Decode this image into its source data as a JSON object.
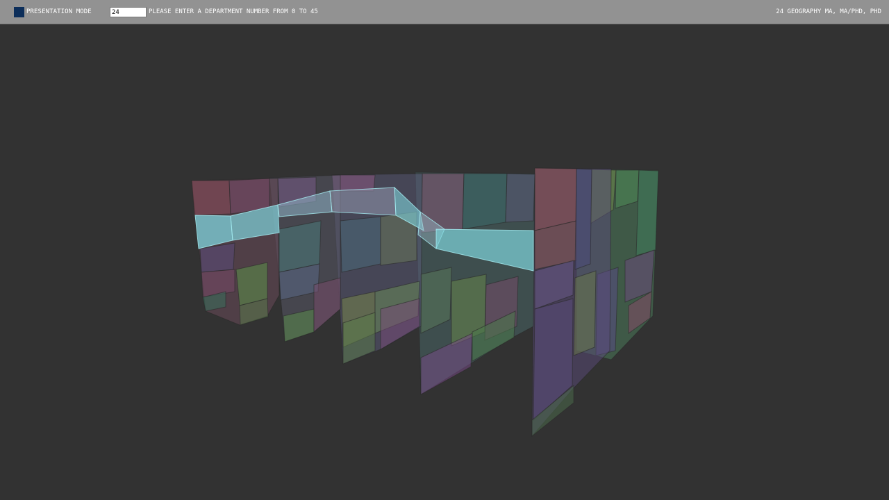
{
  "toolbar": {
    "presentation_toggle_label": "PRESENTATION MODE",
    "department_input_value": "24",
    "department_prompt": "PLEASE ENTER A DEPARTMENT NUMBER FROM 0 TO 45",
    "status_text": "24 GEOGRAPHY  MA, MA/PHD, PHD"
  },
  "colors": {
    "background": "#323232",
    "toolbar": "#929292",
    "toggle_fill": "#0c2e5a",
    "highlight_ribbon": "#7fd4dc"
  },
  "visualization": {
    "name": "3d-department-treemap-layers",
    "highlighted_department": "24",
    "layer_count": 6
  }
}
